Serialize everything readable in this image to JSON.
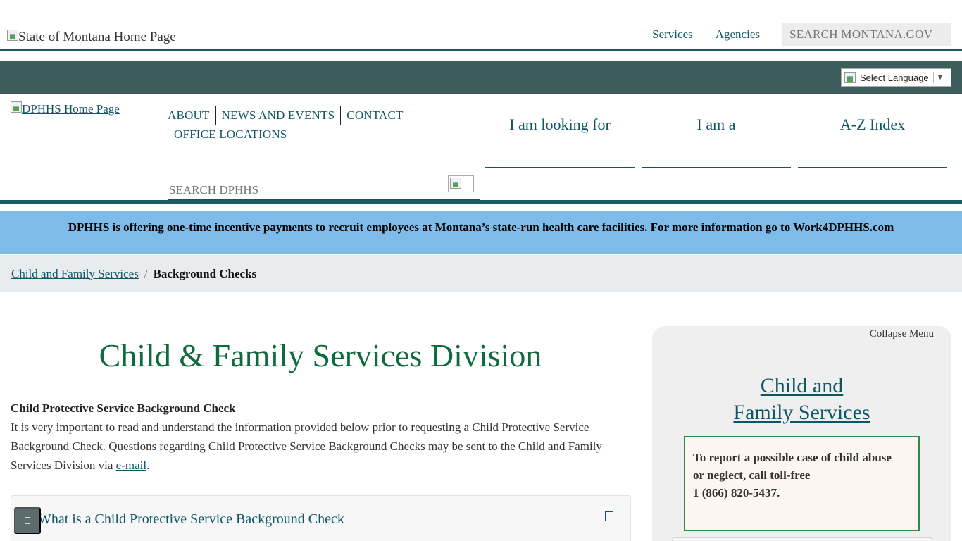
{
  "state_header": {
    "logo_alt": "State of Montana Home Page",
    "links": [
      "Services",
      "Agencies"
    ],
    "search_placeholder": "SEARCH MONTANA.GOV"
  },
  "language": {
    "label": "Select Language",
    "arrow": "▼"
  },
  "dphhs_header": {
    "logo_alt": "DPHHS Home Page",
    "nav": {
      "about": "ABOUT",
      "news": "NEWS AND EVENTS",
      "contact": "CONTACT",
      "locations": "OFFICE LOCATIONS"
    },
    "quick_links": {
      "looking_for": "I am looking for",
      "i_am_a": "I am a",
      "az_index": "A-Z Index"
    },
    "search_placeholder": "SEARCH DPHHS"
  },
  "alert": {
    "text": "DPHHS is offering one-time incentive payments to recruit employees at Montana’s state-run health care facilities. For more information go to ",
    "link": "Work4DPHHS.com"
  },
  "breadcrumb": {
    "parent": "Child and Family Services",
    "separator": "/",
    "current": "Background Checks"
  },
  "main": {
    "title": "Child & Family Services Division",
    "lead": "Child Protective Service Background Check",
    "paragraph_before_link": "It is very important to read and understand the information provided below prior to requesting a Child Protective Service Background Check.  Questions regarding Child Protective Service Background Checks may be sent to the Child and Family Services Division via ",
    "email_link": "e-mail",
    "paragraph_after_link": ".",
    "accordion_title": "What is a Child Protective Service Background Check"
  },
  "sidebar": {
    "collapse_label": "Collapse Menu",
    "title_line1": "Child and",
    "title_line2": "Family Services",
    "report_line1": "To report a possible case of child abuse",
    "report_line2": "or neglect, call toll-free",
    "report_line3": "1 (866) 820-5437."
  }
}
